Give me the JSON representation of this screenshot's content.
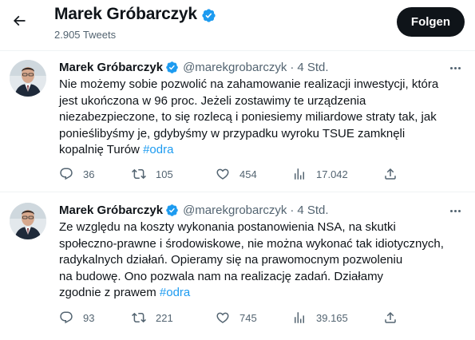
{
  "header": {
    "name": "Marek Gróbarczyk",
    "tweet_count": "2.905 Tweets",
    "follow_label": "Folgen"
  },
  "tweets": [
    {
      "author": "Marek Gróbarczyk",
      "handle": "@marekgrobarczyk",
      "separator": "·",
      "time": "4 Std.",
      "lines": [
        "Nie możemy sobie pozwolić na zahamowanie realizacji inwestycji, która",
        "jest ukończona w 96 proc. Jeżeli zostawimy te urządzenia",
        "niezabezpieczone, to się rozlecą i poniesiemy miliardowe straty tak, jak",
        "ponieślibyśmy je, gdybyśmy w przypadku wyroku TSUE zamknęli",
        "kopalnię Turów"
      ],
      "hashtag": "#odra",
      "replies": "36",
      "retweets": "105",
      "likes": "454",
      "views": "17.042"
    },
    {
      "author": "Marek Gróbarczyk",
      "handle": "@marekgrobarczyk",
      "separator": "·",
      "time": "4 Std.",
      "lines": [
        "Ze względu na koszty wykonania postanowienia NSA, na skutki",
        "społeczno-prawne i środowiskowe, nie można wykonać tak idiotycznych,",
        "radykalnych działań. Opieramy się na prawomocnym pozwoleniu",
        "na budowę. Ono pozwala nam na realizację zadań. Działamy",
        "zgodnie z prawem"
      ],
      "hashtag": "#odra",
      "replies": "93",
      "retweets": "221",
      "likes": "745",
      "views": "39.165"
    }
  ],
  "icons": {
    "back": "arrow-left-icon",
    "verified": "verified-badge-icon",
    "more": "more-icon",
    "reply": "reply-icon",
    "retweet": "retweet-icon",
    "like": "heart-icon",
    "views": "views-icon",
    "share": "share-icon"
  },
  "colors": {
    "accent": "#1d9bf0",
    "text": "#0f1419",
    "muted": "#536471",
    "follow_bg": "#0f1419"
  }
}
